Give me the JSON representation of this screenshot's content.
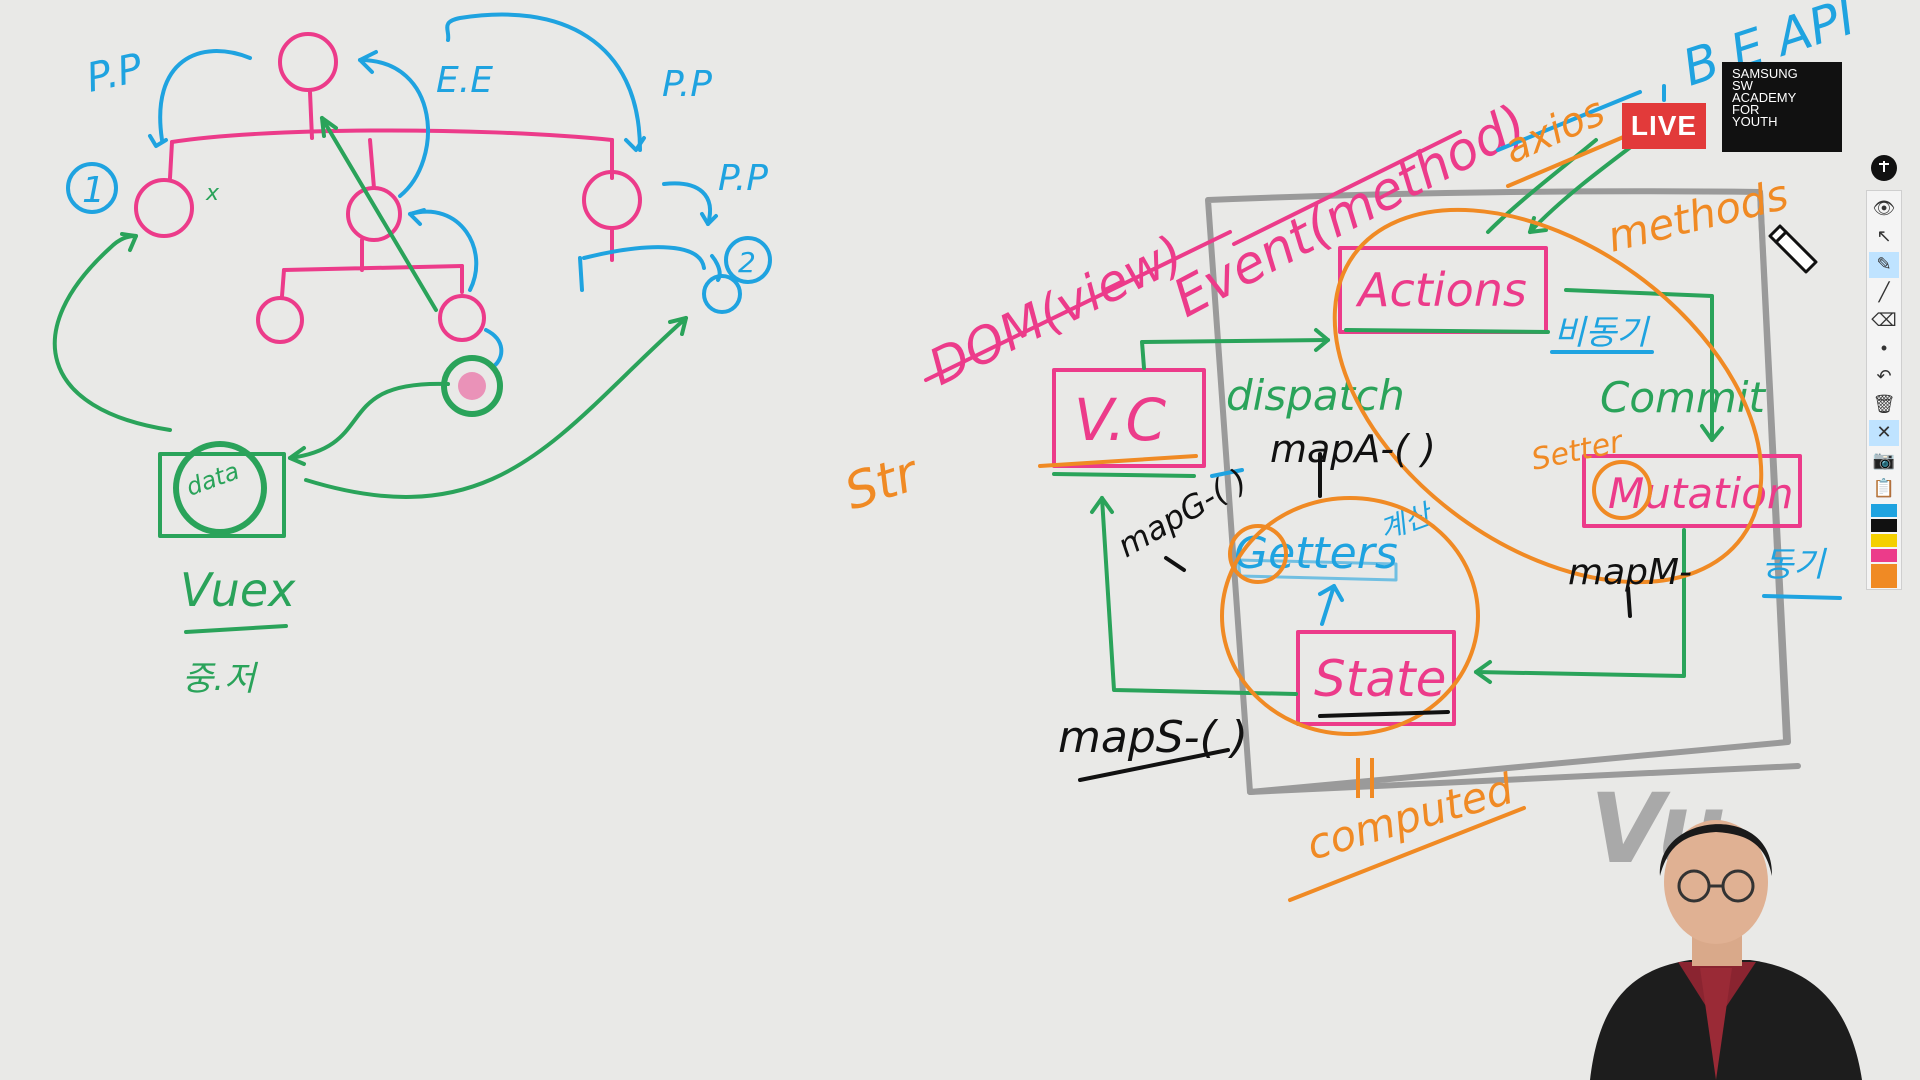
{
  "stream": {
    "live_label": "LIVE",
    "logo_lines": [
      "SAMSUNG",
      "SW",
      "ACADEMY",
      "FOR",
      "YOUTH"
    ]
  },
  "colors": {
    "pink": "#ec3b8a",
    "blue": "#1fa3e0",
    "green": "#2aa35a",
    "orange": "#f08a24",
    "black": "#111111",
    "grey": "#9a9a9a",
    "board": "#e9e9e7"
  },
  "left_diagram": {
    "labels": {
      "pp_top_left": "P.P",
      "ee": "E.E",
      "pp_top_right": "P.P",
      "pp_right": "P.P",
      "num_one": "1",
      "num_two": "2",
      "x_mark": "x",
      "data": "data",
      "vuex": "Vuex",
      "korean_note": "중.저"
    }
  },
  "right_diagram": {
    "labels": {
      "dom_view": "DOM(view)",
      "event_method": "Event(method)",
      "b_e_api": "B.E API",
      "axios": "axios",
      "methods": "methods",
      "actions": "Actions",
      "bidonggi": "비동기",
      "dispatch": "dispatch",
      "commit": "Commit",
      "vc": "V.C",
      "map_a": "mapA-( )",
      "setter": "Setter",
      "mutation": "Mutation",
      "str": "Str",
      "map_g": "mapG-( )",
      "getters": "Getters",
      "getter_note": "계산",
      "map_m": "mapM-",
      "donggi": "동기",
      "state": "State",
      "map_s": "mapS-( )",
      "computed": "computed",
      "vuex_partial": "Vu"
    }
  },
  "toolbar": {
    "tools": [
      {
        "name": "eye-icon",
        "glyph": "👁"
      },
      {
        "name": "pointer-icon",
        "glyph": "↖"
      },
      {
        "name": "pen-icon",
        "glyph": "✎"
      },
      {
        "name": "line-icon",
        "glyph": "╱"
      },
      {
        "name": "eraser-icon",
        "glyph": "⌫"
      },
      {
        "name": "dot-icon",
        "glyph": "•"
      },
      {
        "name": "undo-icon",
        "glyph": "↶"
      },
      {
        "name": "trash-icon",
        "glyph": "🗑"
      },
      {
        "name": "close-board-icon",
        "glyph": "✕"
      },
      {
        "name": "camera-icon",
        "glyph": "📷"
      },
      {
        "name": "clipboard-icon",
        "glyph": "📋"
      }
    ],
    "swatches": [
      "#1fa3e0",
      "#111111",
      "#f4d000",
      "#ec3b8a",
      "#f08a24"
    ]
  }
}
